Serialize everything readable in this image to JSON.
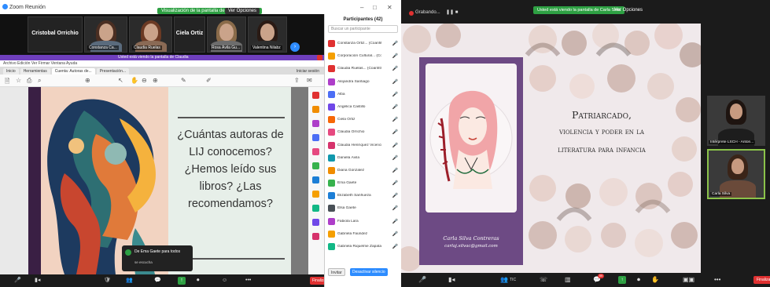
{
  "left": {
    "app_title": "Zoom Reunión",
    "share_banner": "Visualización de la pantalla de Claudia Ruelas",
    "view_options": "Ver Opciones",
    "gallery": [
      {
        "name": "Constanza Ca..."
      },
      {
        "name": "Claudia Ruelas"
      },
      {
        "name": "Cristobal Orrichio"
      },
      {
        "name": "Ciela Ortiz"
      },
      {
        "name": "Rosa Ávila Gu..."
      },
      {
        "name": "Valentina Nilabz"
      }
    ],
    "gallery_name_only": [
      "Cristobal Orrichio",
      "Ciela Ortiz"
    ],
    "sharing_bar": "Usted está viendo la pantalla de Claudia",
    "pdf_menu": "Archivo   Edición   Ver   Firmar   Ventana   Ayuda",
    "pdf_tabs": [
      "Inicio",
      "Herramientas",
      "Cuenta: Autoras de...",
      "Presentación..."
    ],
    "pdf_share_label": "Iniciar sesión",
    "slide_text": "¿Cuántas autoras de LIJ conocemos? ¿Hemos leído sus libros? ¿Las recomendamos?",
    "toast_title": "De Ema Gaete para todos",
    "toast_body": "se escucha",
    "controls": [
      "Audio",
      "Video",
      "Participantes",
      "Chat",
      "Compartir",
      "Grabar",
      "Reacciones"
    ],
    "end_label": "Finalizar",
    "participants_count": "42"
  },
  "panel": {
    "title": "Participantes (42)",
    "search_placeholder": "Buscar un participante",
    "participants": [
      {
        "name": "Constanza Ortiz... (Coanfitrión, yo)",
        "color": "#e03131"
      },
      {
        "name": "Corporación Cultural... (Coanfitrión)",
        "color": "#f59f00"
      },
      {
        "name": "Claudia Ruelas... (Coanfitrión)",
        "color": "#e03131"
      },
      {
        "name": "Alejandra Santiago",
        "color": "#ae3ec9"
      },
      {
        "name": "Alba",
        "color": "#4c6ef5"
      },
      {
        "name": "Angélica Castillo",
        "color": "#7048e8"
      },
      {
        "name": "Ciela Ortiz",
        "color": "#f76707"
      },
      {
        "name": "Claudia Orrichio",
        "color": "#e64980"
      },
      {
        "name": "Claudia Henríquez Vicencio",
        "color": "#d6336c"
      },
      {
        "name": "Daniela Ávila",
        "color": "#1098ad"
      },
      {
        "name": "Diana Gonzalez",
        "color": "#f08c00"
      },
      {
        "name": "Ema Gaete",
        "color": "#37b24d"
      },
      {
        "name": "Elizabeth Sanhueza",
        "color": "#1c7ed6"
      },
      {
        "name": "Elsa Gaete",
        "color": "#495057"
      },
      {
        "name": "Fabiola Lara",
        "color": "#ae3ec9"
      },
      {
        "name": "Gabriela Faúndez",
        "color": "#f59f00"
      },
      {
        "name": "Gabriela Riquelme Zapata",
        "color": "#12b886"
      }
    ],
    "invite_label": "Invitar",
    "unmute_label": "Desactivar silencio"
  },
  "right": {
    "recording_label": "Grabando...",
    "share_banner": "Usted está viendo la pantalla de Carla Silva",
    "view_options": "Ver Opciones",
    "cover_author": "Carla Silva Contreras",
    "cover_email": "carlaj.silvac@gmail.com",
    "title_line1": "Patriarcado,",
    "title_line2": "violencia y poder en la",
    "title_line3": "literatura para infancia",
    "videos": [
      {
        "name": "Intérprete LSCH - Anton..."
      },
      {
        "name": "Carla Silva"
      }
    ],
    "controls": [
      "Audio",
      "Video",
      "Participantes",
      "Chat",
      "Compartir",
      "Grabar",
      "Reacciones",
      "Más"
    ],
    "participants_count": "TIC",
    "chat_badge": "99",
    "end_label": "Finalizar"
  }
}
